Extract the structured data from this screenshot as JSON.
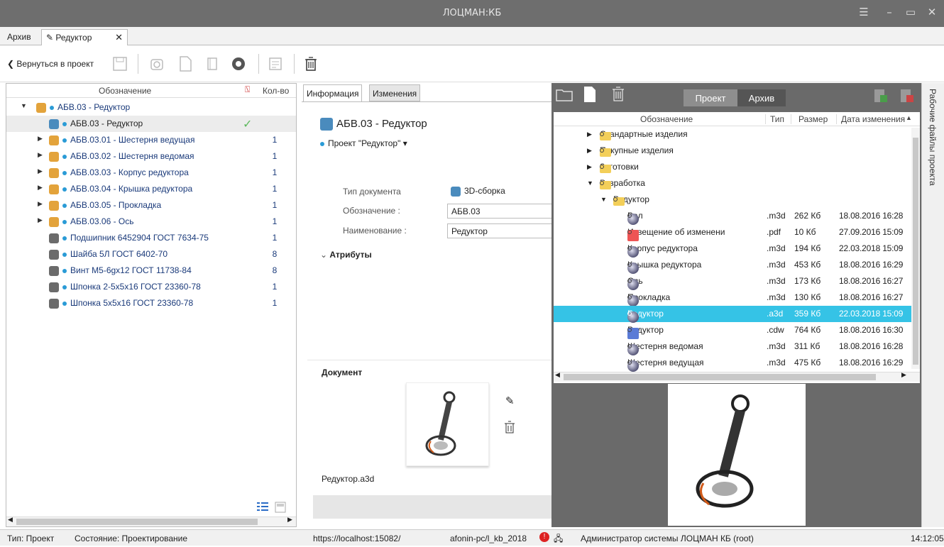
{
  "window": {
    "title": "ЛОЦМАН:КБ"
  },
  "tabs": [
    {
      "label": "Архив"
    },
    {
      "label": "Редуктор"
    }
  ],
  "toolbar": {
    "back_label": "Вернуться в проект"
  },
  "left_tree": {
    "col_designation": "Обозначение",
    "col_qty": "Кол-во",
    "root": "АБВ.03 - Редуктор",
    "rows": [
      {
        "label": "АБВ.03 - Редуктор",
        "qty": ""
      },
      {
        "label": "АБВ.03.01 - Шестерня ведущая",
        "qty": "1"
      },
      {
        "label": "АБВ.03.02 - Шестерня ведомая",
        "qty": "1"
      },
      {
        "label": "АБВ.03.03 - Корпус редуктора",
        "qty": "1"
      },
      {
        "label": "АБВ.03.04 - Крышка редуктора",
        "qty": "1"
      },
      {
        "label": "АБВ.03.05 - Прокладка",
        "qty": "1"
      },
      {
        "label": "АБВ.03.06 - Ось",
        "qty": "1"
      },
      {
        "label": "Подшипник 6452904 ГОСТ 7634-75",
        "qty": "1"
      },
      {
        "label": "Шайба 5Л ГОСТ 6402-70",
        "qty": "8"
      },
      {
        "label": "Винт М5-6gx12 ГОСТ 11738-84",
        "qty": "8"
      },
      {
        "label": "Шпонка 2-5х5х16 ГОСТ 23360-78",
        "qty": "1"
      },
      {
        "label": "Шпонка 5х5х16 ГОСТ 23360-78",
        "qty": "1"
      }
    ],
    "check_mark": "✓"
  },
  "info": {
    "tab_info": "Информация",
    "tab_changes": "Изменения",
    "heading": "АБВ.03 - Редуктор",
    "project_link": "Проект \"Редуктор\"",
    "doc_type_label": "Тип документа",
    "doc_type_value": "3D-сборка",
    "designation_label": "Обозначение :",
    "designation_value": "АБВ.03",
    "name_label": "Наименование :",
    "name_value": "Редуктор",
    "attributes_label": "Атрибуты",
    "document_label": "Документ",
    "file_name": "Редуктор.a3d"
  },
  "files": {
    "toggle_project": "Проект",
    "toggle_archive": "Архив",
    "col_designation": "Обозначение",
    "col_type": "Тип",
    "col_size": "Размер",
    "col_date": "Дата изменения",
    "folders": [
      {
        "label": "Стандартные изделия"
      },
      {
        "label": "Покупные изделия"
      },
      {
        "label": "Заготовки"
      },
      {
        "label": "Разработка"
      },
      {
        "label": "Редуктор"
      }
    ],
    "items": [
      {
        "name": "Вал",
        "type": ".m3d",
        "size": "262 Кб",
        "date": "18.08.2016 16:28"
      },
      {
        "name": "Извещение об изменени",
        "type": ".pdf",
        "size": "10 Кб",
        "date": "27.09.2016 15:09"
      },
      {
        "name": "Корпус редуктора",
        "type": ".m3d",
        "size": "194 Кб",
        "date": "22.03.2018 15:09"
      },
      {
        "name": "Крышка редуктора",
        "type": ".m3d",
        "size": "453 Кб",
        "date": "18.08.2016 16:29"
      },
      {
        "name": "Ось",
        "type": ".m3d",
        "size": "173 Кб",
        "date": "18.08.2016 16:27"
      },
      {
        "name": "Прокладка",
        "type": ".m3d",
        "size": "130 Кб",
        "date": "18.08.2016 16:27"
      },
      {
        "name": "Редуктор",
        "type": ".a3d",
        "size": "359 Кб",
        "date": "22.03.2018 15:09"
      },
      {
        "name": "Редуктор",
        "type": ".cdw",
        "size": "764 Кб",
        "date": "18.08.2016 16:30"
      },
      {
        "name": "Шестерня ведомая",
        "type": ".m3d",
        "size": "311 Кб",
        "date": "18.08.2016 16:28"
      },
      {
        "name": "Шестерня ведущая",
        "type": ".m3d",
        "size": "475 Кб",
        "date": "18.08.2016 16:29"
      }
    ]
  },
  "side_tab": "Рабочие файлы проекта",
  "status": {
    "type": "Тип: Проект",
    "state": "Состояние: Проектирование",
    "url": "https://localhost:15082/",
    "db": "afonin-pc/l_kb_2018",
    "user": "Администратор системы ЛОЦМАН КБ (root)",
    "time": "14:12:05"
  },
  "colors": {
    "accent": "#2a9bd6",
    "selected_row": "#35c3e6",
    "titlebar": "#6e6e6e"
  }
}
